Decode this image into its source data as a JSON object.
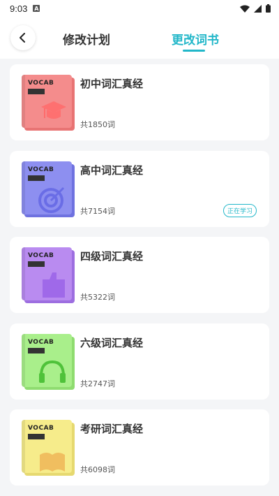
{
  "status_bar": {
    "time": "9:03",
    "notif_icon": "A"
  },
  "header": {
    "tabs": [
      {
        "label": "修改计划"
      },
      {
        "label": "更改词书"
      }
    ],
    "active_tab": 1,
    "accent_color": "#22b7c9"
  },
  "cover_text": "VOCAB",
  "books": [
    {
      "title": "初中词汇真经",
      "count": "共1850词",
      "color": "#f48c8c",
      "shadow": "#e87474",
      "art": "mortarboard-icon"
    },
    {
      "title": "高中词汇真经",
      "count": "共7154词",
      "color": "#8d8ff0",
      "shadow": "#6f72e0",
      "art": "target-icon",
      "badge": "正在学习"
    },
    {
      "title": "四级词汇真经",
      "count": "共5322词",
      "color": "#b98bf0",
      "shadow": "#9d6ee0",
      "art": "thumbs-up-icon"
    },
    {
      "title": "六级词汇真经",
      "count": "共2747词",
      "color": "#a9ef8b",
      "shadow": "#8fdc70",
      "art": "headphones-icon"
    },
    {
      "title": "考研词汇真经",
      "count": "共6098词",
      "color": "#f6ec8b",
      "shadow": "#e6d970",
      "art": "book-icon"
    }
  ]
}
